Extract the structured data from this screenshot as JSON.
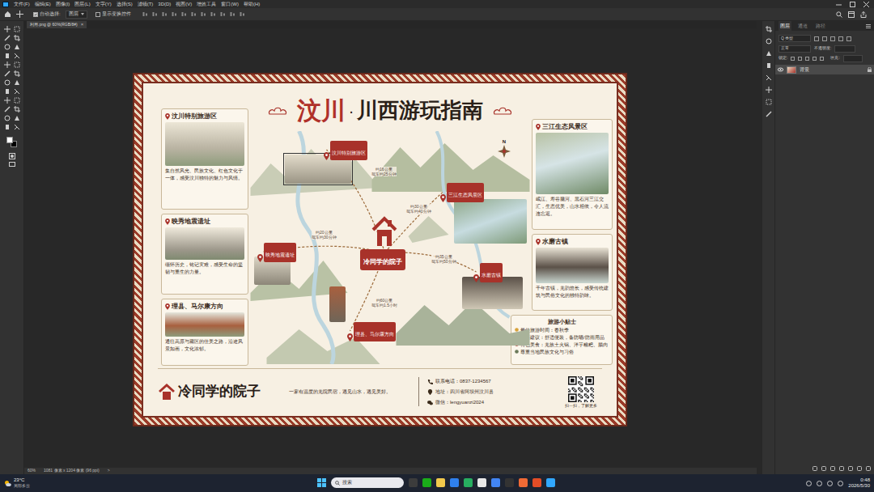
{
  "menu": [
    "文件(F)",
    "编辑(E)",
    "图像(I)",
    "图层(L)",
    "文字(Y)",
    "选择(S)",
    "滤镜(T)",
    "3D(D)",
    "视图(V)",
    "增效工具",
    "窗口(W)",
    "帮助(H)"
  ],
  "options": {
    "auto_select_label": "自动选择:",
    "auto_select": true,
    "target": "图层",
    "show_transform": "显示变换控件",
    "show_transform_checked": false
  },
  "document_tab": {
    "label": "利用.png @ 60%(RGB/8#)",
    "close": "×"
  },
  "status_bar": {
    "zoom": "60%",
    "info": "1081 像素 x 1204 像素 (96 ppi)",
    "arrow": ">"
  },
  "layers_panel": {
    "tabs": [
      {
        "label": "图层",
        "selected": true
      },
      {
        "label": "通道",
        "selected": false
      },
      {
        "label": "路径",
        "selected": false
      }
    ],
    "filter": "Q 类型",
    "blend": "正常",
    "opacity_label": "不透明度:",
    "lock_label": "锁定:",
    "fill_label": "填充:",
    "layers": [
      {
        "name": "背景",
        "visible": true,
        "locked": true,
        "selected": true
      }
    ]
  },
  "poster": {
    "title": {
      "main": "汶川",
      "dot": "·",
      "sub": "川西游玩指南"
    },
    "left_cards": [
      {
        "title": "汶川特别旅游区",
        "text": "集自然风光、民族文化、红色文化于一体，感受汶川独特的魅力与风情。"
      },
      {
        "title": "映秀地震遗址",
        "text": "缅怀历史，铭记灾难，感受生命的坚韧与重生的力量。"
      },
      {
        "title": "理县、马尔康方向",
        "text": "通往高原与藏区的佳美之路，沿途风景如画，文化浓郁。"
      }
    ],
    "right_cards": [
      {
        "title": "三江生态风景区",
        "text": "岷江、寿谷脑河、黑石河三江交汇，生态优美，山水相依，令人流连忘返。"
      },
      {
        "title": "水磨古镇",
        "text": "千年古镇，羌韵悠长，感受传统建筑与民俗文化的独特韵味。"
      }
    ],
    "tips": {
      "title": "旅游小贴士",
      "items": [
        "最佳旅游时间：春秋季",
        "穿着建议：舒适便装，备防晒/防雨用品",
        "特色美食：羌族土火锅、洋芋糍粑、腊肉",
        "尊重当地民族文化与习俗"
      ]
    },
    "map": {
      "center": "冷同学的院子",
      "compass": "N",
      "pins": [
        "汶川特别旅游区",
        "三江生态风景区",
        "映秀地震遗址",
        "水磨古镇",
        "理县、马尔康方向"
      ],
      "routes": [
        {
          "distance": "约16公里",
          "time": "驾车约25分钟"
        },
        {
          "distance": "约30公里",
          "time": "驾车约40分钟"
        },
        {
          "distance": "约20公里",
          "time": "驾车约30分钟"
        },
        {
          "distance": "约35公里",
          "time": "驾车约50分钟"
        },
        {
          "distance": "约60公里",
          "time": "驾车约1.5小时"
        }
      ]
    },
    "footer": {
      "brand": "冷同学的院子",
      "slogan": "一家有温度的羌院民宿，遇见山水，遇见美好。",
      "contacts": [
        "联系电话：0837-1234567",
        "地址：四川省阿坝州汶川县",
        "微信：lengyuanzi2024"
      ],
      "qr_caption": "扫一扫，了解更多"
    }
  },
  "taskbar": {
    "temperature": "23°C",
    "weather": "局部多云",
    "search": "搜索",
    "time": "0:48",
    "date": "2026/5/30"
  }
}
